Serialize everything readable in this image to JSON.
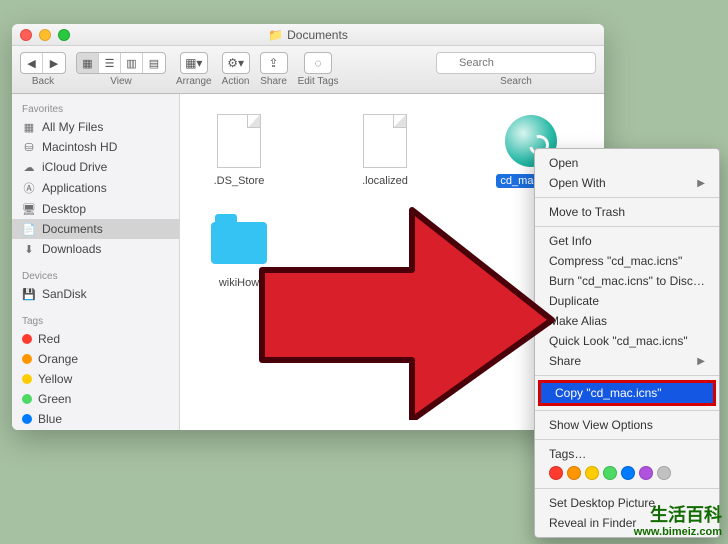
{
  "window": {
    "title": "Documents"
  },
  "toolbar": {
    "back_label": "Back",
    "view_label": "View",
    "arrange_label": "Arrange",
    "action_label": "Action",
    "share_label": "Share",
    "edit_tags_label": "Edit Tags",
    "search_label": "Search",
    "search_placeholder": "Search"
  },
  "sidebar": {
    "sections": [
      {
        "title": "Favorites",
        "items": [
          {
            "icon": "all-my-files-icon",
            "glyph": "▦",
            "label": "All My Files"
          },
          {
            "icon": "hdd-icon",
            "glyph": "⛁",
            "label": "Macintosh HD"
          },
          {
            "icon": "cloud-icon",
            "glyph": "☁",
            "label": "iCloud Drive"
          },
          {
            "icon": "apps-icon",
            "glyph": "Ⓐ",
            "label": "Applications"
          },
          {
            "icon": "desktop-icon",
            "glyph": "🖥",
            "label": "Desktop"
          },
          {
            "icon": "documents-icon",
            "glyph": "📄",
            "label": "Documents",
            "selected": true
          },
          {
            "icon": "downloads-icon",
            "glyph": "⬇",
            "label": "Downloads"
          }
        ]
      },
      {
        "title": "Devices",
        "items": [
          {
            "icon": "sd-icon",
            "glyph": "💾",
            "label": "SanDisk"
          }
        ]
      },
      {
        "title": "Tags",
        "items": [
          {
            "tag": "tag-red",
            "label": "Red"
          },
          {
            "tag": "tag-orange",
            "label": "Orange"
          },
          {
            "tag": "tag-yellow",
            "label": "Yellow"
          },
          {
            "tag": "tag-green",
            "label": "Green"
          },
          {
            "tag": "tag-blue",
            "label": "Blue"
          }
        ]
      }
    ]
  },
  "files": [
    {
      "name": ".DS_Store",
      "kind": "blank"
    },
    {
      "name": ".localized",
      "kind": "blank"
    },
    {
      "name": "cd_mac.icns",
      "kind": "icns",
      "selected": true
    },
    {
      "name": "wikiHow",
      "kind": "folder"
    }
  ],
  "context_menu": {
    "open": "Open",
    "open_with": "Open With",
    "move_to_trash": "Move to Trash",
    "get_info": "Get Info",
    "compress": "Compress \"cd_mac.icns\"",
    "burn": "Burn \"cd_mac.icns\" to Disc…",
    "duplicate": "Duplicate",
    "make_alias": "Make Alias",
    "quick_look": "Quick Look \"cd_mac.icns\"",
    "share": "Share",
    "copy": "Copy \"cd_mac.icns\"",
    "show_view_options": "Show View Options",
    "tags": "Tags…",
    "set_desktop_picture": "Set Desktop Picture",
    "reveal_in_finder": "Reveal in Finder"
  },
  "watermark": {
    "line1": "生活百科",
    "line2": "www.bimeiz.com"
  }
}
